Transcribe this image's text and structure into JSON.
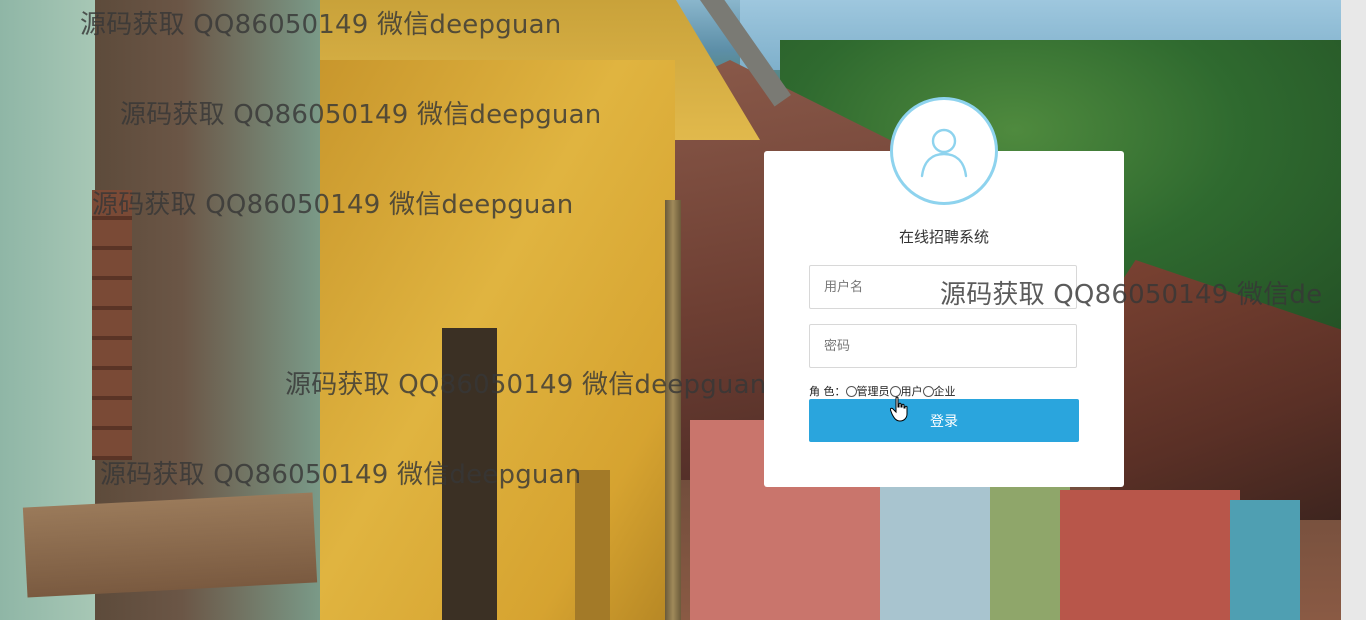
{
  "watermarks": [
    "源码获取 QQ86050149 微信deepguan",
    "源码获取 QQ86050149 微信deepguan",
    "源码获取 QQ86050149 微信deepguan",
    "源码获取 QQ86050149 微信deepguan",
    "源码获取 QQ86050149 微信deepguan",
    "源码获取 QQ86050149 微信de"
  ],
  "login": {
    "title": "在线招聘系统",
    "avatar_icon": "user-icon",
    "username_placeholder": "用户名",
    "password_placeholder": "密码",
    "role_label": "角 色：",
    "roles": [
      "管理员",
      "用户",
      "企业"
    ],
    "submit_label": "登录"
  },
  "colors": {
    "button": "#2aa5dd",
    "avatar_border": "#8ed3ee"
  }
}
